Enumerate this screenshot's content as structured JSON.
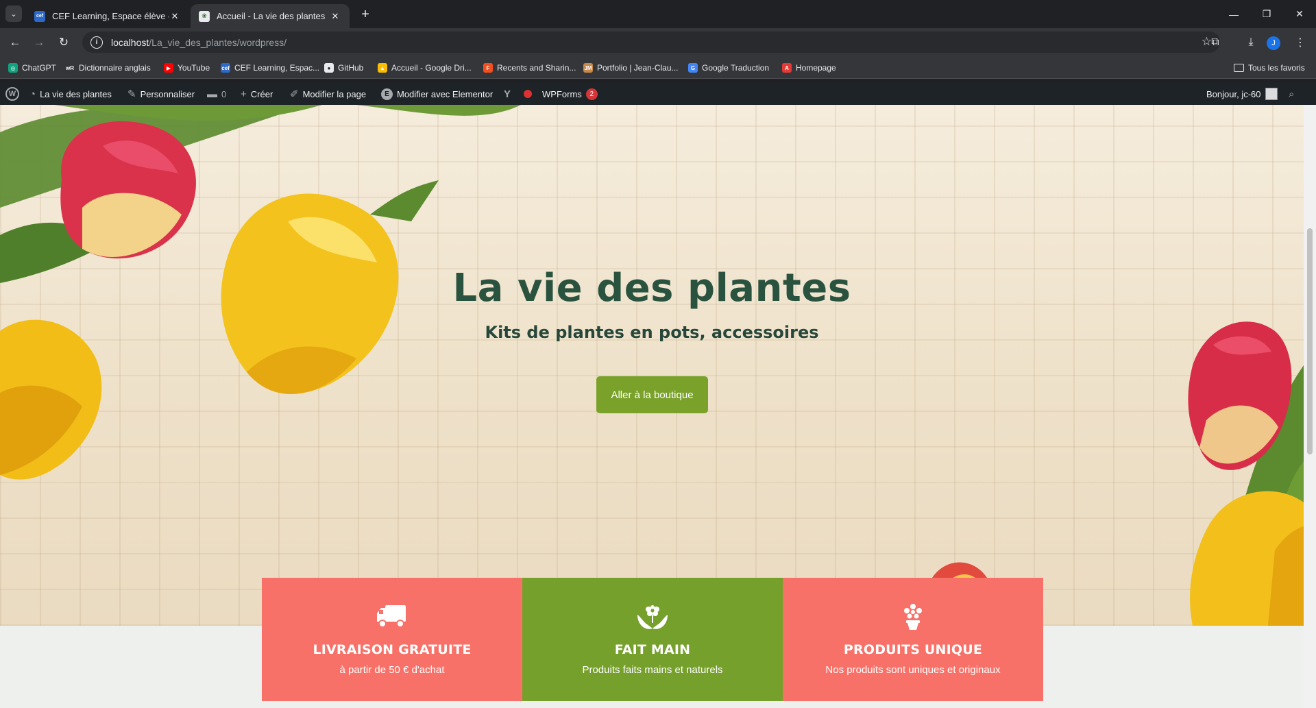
{
  "browser": {
    "tab_search_label": "⌄",
    "tabs": [
      {
        "title": "CEF Learning, Espace élève du C",
        "favicon": "cef",
        "active": false
      },
      {
        "title": "Accueil - La vie des plantes",
        "favicon": "leaf",
        "active": true
      }
    ],
    "new_tab": "+",
    "window_controls": {
      "minimize": "—",
      "restore": "❐",
      "close": "✕"
    },
    "url_host": "localhost",
    "url_path": "/La_vie_des_plantes/wordpress/",
    "profile_initial": "J",
    "bookmarks": [
      {
        "label": "ChatGPT",
        "icon": "chatgpt-icon",
        "color": "#10a37f",
        "glyph": "◎"
      },
      {
        "label": "Dictionnaire anglais",
        "icon": "wordreference-icon",
        "color": "#34353a",
        "glyph": "wR"
      },
      {
        "label": "YouTube",
        "icon": "youtube-icon",
        "color": "#ff0000",
        "glyph": "▶"
      },
      {
        "label": "CEF Learning, Espac...",
        "icon": "cef-icon",
        "color": "#2d69c9",
        "glyph": "cef"
      },
      {
        "label": "GitHub",
        "icon": "github-icon",
        "color": "#e8eaed",
        "glyph": "●"
      },
      {
        "label": "Accueil - Google Dri...",
        "icon": "google-drive-icon",
        "color": "#fbbc04",
        "glyph": "▲"
      },
      {
        "label": "Recents and Sharin...",
        "icon": "figma-icon",
        "color": "#f24e1e",
        "glyph": "F"
      },
      {
        "label": "Portfolio | Jean-Clau...",
        "icon": "portfolio-icon",
        "color": "#c7894b",
        "glyph": "JM"
      },
      {
        "label": "Google Traduction",
        "icon": "google-translate-icon",
        "color": "#4285f4",
        "glyph": "G"
      },
      {
        "label": "Homepage",
        "icon": "homepage-icon",
        "color": "#e53935",
        "glyph": "A"
      }
    ],
    "all_bookmarks_label": "Tous les favoris"
  },
  "wp_admin_bar": {
    "site_name": "La vie des plantes",
    "customize": "Personnaliser",
    "comments_count": "0",
    "new": "Créer",
    "edit_page": "Modifier la page",
    "edit_elementor": "Modifier avec Elementor",
    "wpforms": "WPForms",
    "wpforms_badge": "2",
    "greeting": "Bonjour, jc-60"
  },
  "hero": {
    "title": "La vie des plantes",
    "subtitle": "Kits de plantes en pots, accessoires",
    "button_label": "Aller à la boutique"
  },
  "features": [
    {
      "title": "LIVRAISON GRATUITE",
      "text": "à partir de 50 € d'achat",
      "icon": "delivery-truck-icon",
      "color": "#f87168"
    },
    {
      "title": "FAIT MAIN",
      "text": "Produits faits mains et naturels",
      "icon": "hands-flower-icon",
      "color": "#76a02c"
    },
    {
      "title": "PRODUITS UNIQUE",
      "text": "Nos produits sont uniques et originaux",
      "icon": "flower-pot-icon",
      "color": "#f87168"
    }
  ],
  "colors": {
    "hero_title": "#2a533f",
    "button": "#7aa22b",
    "coral": "#f87168",
    "green": "#76a02c"
  }
}
